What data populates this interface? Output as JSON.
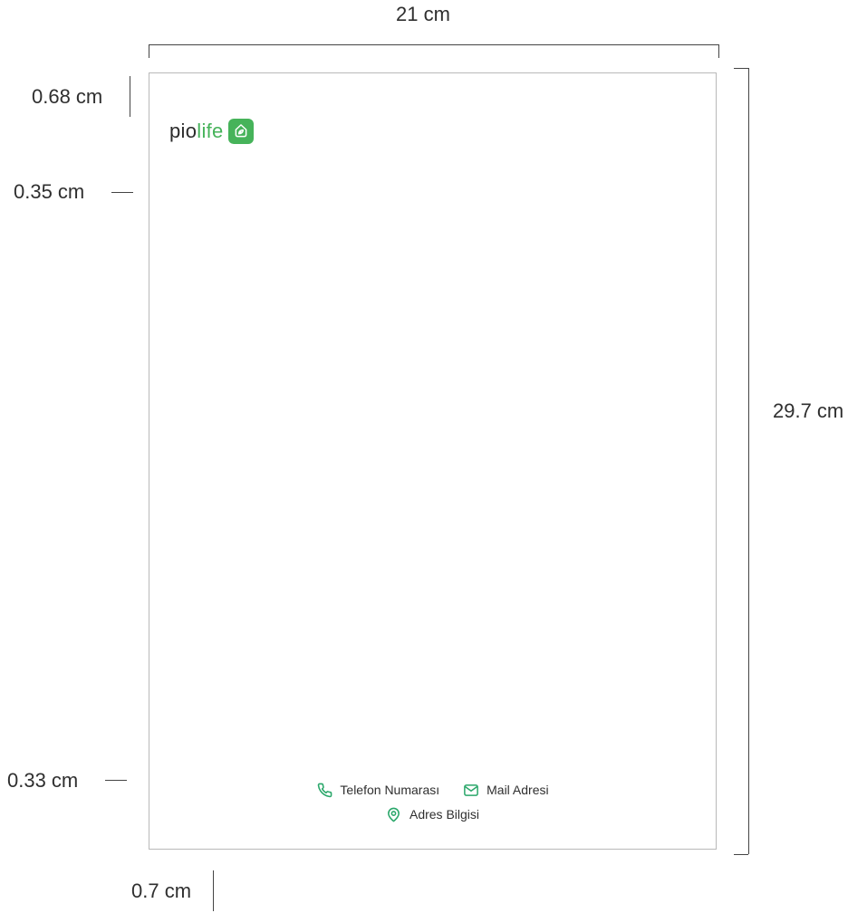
{
  "dimensions": {
    "page_width": "21 cm",
    "page_height": "29.7 cm",
    "top_margin": "0.68 cm",
    "logo_spacing": "0.35 cm",
    "footer_spacing": "0.33 cm",
    "bottom_margin": "0.7 cm"
  },
  "logo": {
    "prefix": "pio",
    "suffix": "life",
    "icon": "leaf-icon"
  },
  "contact": {
    "phone": "Telefon Numarası",
    "phone_icon": "phone-icon",
    "mail": "Mail Adresi",
    "mail_icon": "mail-icon",
    "address": "Adres Bilgisi",
    "address_icon": "location-pin-icon"
  },
  "colors": {
    "brand_green": "#46b35a",
    "text": "#2b2b2b",
    "page_border": "#b9b9b9"
  }
}
